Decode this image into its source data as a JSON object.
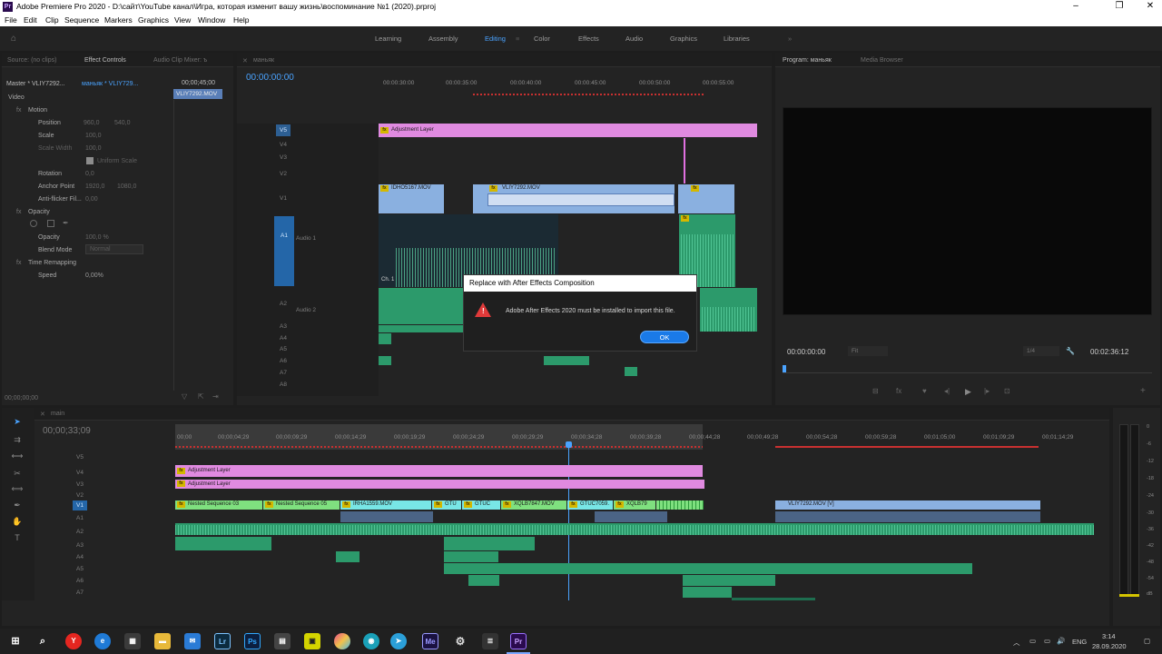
{
  "app": {
    "title": "Adobe Premiere Pro 2020 - D:\\сайт\\YouTube канал\\Игра, которая изменит вашу жизнь\\воспоминание №1 (2020).prproj",
    "icon": "Pr",
    "accent": "#4aa3ff"
  },
  "menu": [
    "File",
    "Edit",
    "Clip",
    "Sequence",
    "Markers",
    "Graphics",
    "View",
    "Window",
    "Help"
  ],
  "workspaces": {
    "items": [
      "Learning",
      "Assembly",
      "Editing",
      "Color",
      "Effects",
      "Audio",
      "Graphics",
      "Libraries"
    ],
    "active": "Editing"
  },
  "source_panel": {
    "tabs": [
      "Source: (no clips)",
      "Effect Controls",
      "Audio Clip Mixer: ъ"
    ],
    "master_label": "Master * VLIY7292...",
    "sequence_label": "маньяк * VLIY729...",
    "timecode": "00;00;45;00",
    "clip_name": "VLIY7292.MOV",
    "section_video": "Video",
    "motion": "Motion",
    "position": {
      "label": "Position",
      "x": "960,0",
      "y": "540,0"
    },
    "scale": {
      "label": "Scale",
      "value": "100,0"
    },
    "scale_width": {
      "label": "Scale Width",
      "value": "100,0"
    },
    "uniform_scale": "Uniform Scale",
    "rotation": {
      "label": "Rotation",
      "value": "0,0"
    },
    "anchor": {
      "label": "Anchor Point",
      "x": "1920,0",
      "y": "1080,0"
    },
    "antiflicker": {
      "label": "Anti-flicker Fil...",
      "value": "0,00"
    },
    "opacity_section": "Opacity",
    "opacity": {
      "label": "Opacity",
      "value": "100,0 %"
    },
    "blend_mode": {
      "label": "Blend Mode",
      "value": "Normal"
    },
    "time_remap": "Time Remapping",
    "speed": {
      "label": "Speed",
      "value": "0,00%"
    },
    "bottom_timecode": "00;00;00;00"
  },
  "upper_timeline": {
    "timecode": "00:00:00:00",
    "ruler": [
      "00:00:30:00",
      "00:00:35:00",
      "00:00:40:00",
      "00:00:45:00",
      "00:00:50:00",
      "00:00:55:00"
    ],
    "video_tracks": [
      "V5",
      "V4",
      "V3",
      "V2",
      "V1"
    ],
    "audio_tracks": [
      "A1",
      "A2",
      "A3",
      "A4",
      "A5",
      "A6",
      "A7",
      "A8"
    ],
    "audio1_name": "Audio 1",
    "audio2_name": "Audio 2",
    "clips": {
      "adjustment": "Adjustment Layer",
      "v1a": "IDHO5167.MOV",
      "v1b": "VLIY7292.MOV",
      "ch1": "Ch. 1"
    }
  },
  "program_panel": {
    "tabs": [
      "Program: маньяк",
      "Media Browser"
    ],
    "timecode": "00:00:00:00",
    "fit": "Fit",
    "ratio": "1/4",
    "duration": "00:02:36:12"
  },
  "dialog": {
    "title": "Replace with After Effects Composition",
    "message": "Adobe After Effects 2020 must be installed to import this file.",
    "ok": "OK",
    "warning_color": "#e03a3a"
  },
  "lower_timeline": {
    "tab": "main",
    "timecode": "00;00;33;09",
    "ruler": [
      "00;00",
      "00;00;04;29",
      "00;00;09;29",
      "00;00;14;29",
      "00;00;19;29",
      "00;00;24;29",
      "00;00;29;29",
      "00;00;34;28",
      "00;00;39;28",
      "00;00;44;28",
      "00;00;49;28",
      "00;00;54;28",
      "00;00;59;28",
      "00;01;05;00",
      "00;01;09;29",
      "00;01;14;29"
    ],
    "video_tracks": [
      "V5",
      "V4",
      "V3",
      "V2",
      "V1"
    ],
    "audio_tracks": [
      "A1",
      "A2",
      "A3",
      "A4",
      "A5",
      "A6",
      "A7"
    ],
    "clips": {
      "adj1": "Adjustment Layer",
      "adj2": "Adjustment Layer",
      "nest3": "Nested Sequence 03",
      "nest5": "Nested Sequence 05",
      "irha": "IRHA1559.MOV",
      "gtu": "GTU",
      "gtuc": "GTUC",
      "xqlb7847": "XQLB7847.MOV",
      "gtuc7059": "GTUC7059.",
      "xqlb79": "XQLB79",
      "vliy": "VLIY7292.MOV [V]"
    }
  },
  "meter": {
    "ticks": [
      "0",
      "-6",
      "-12",
      "-18",
      "-24",
      "-30",
      "-36",
      "-42",
      "-48",
      "-54",
      "dB"
    ]
  },
  "taskbar": {
    "lang": "ENG",
    "time": "3:14",
    "date": "28.09.2020"
  }
}
